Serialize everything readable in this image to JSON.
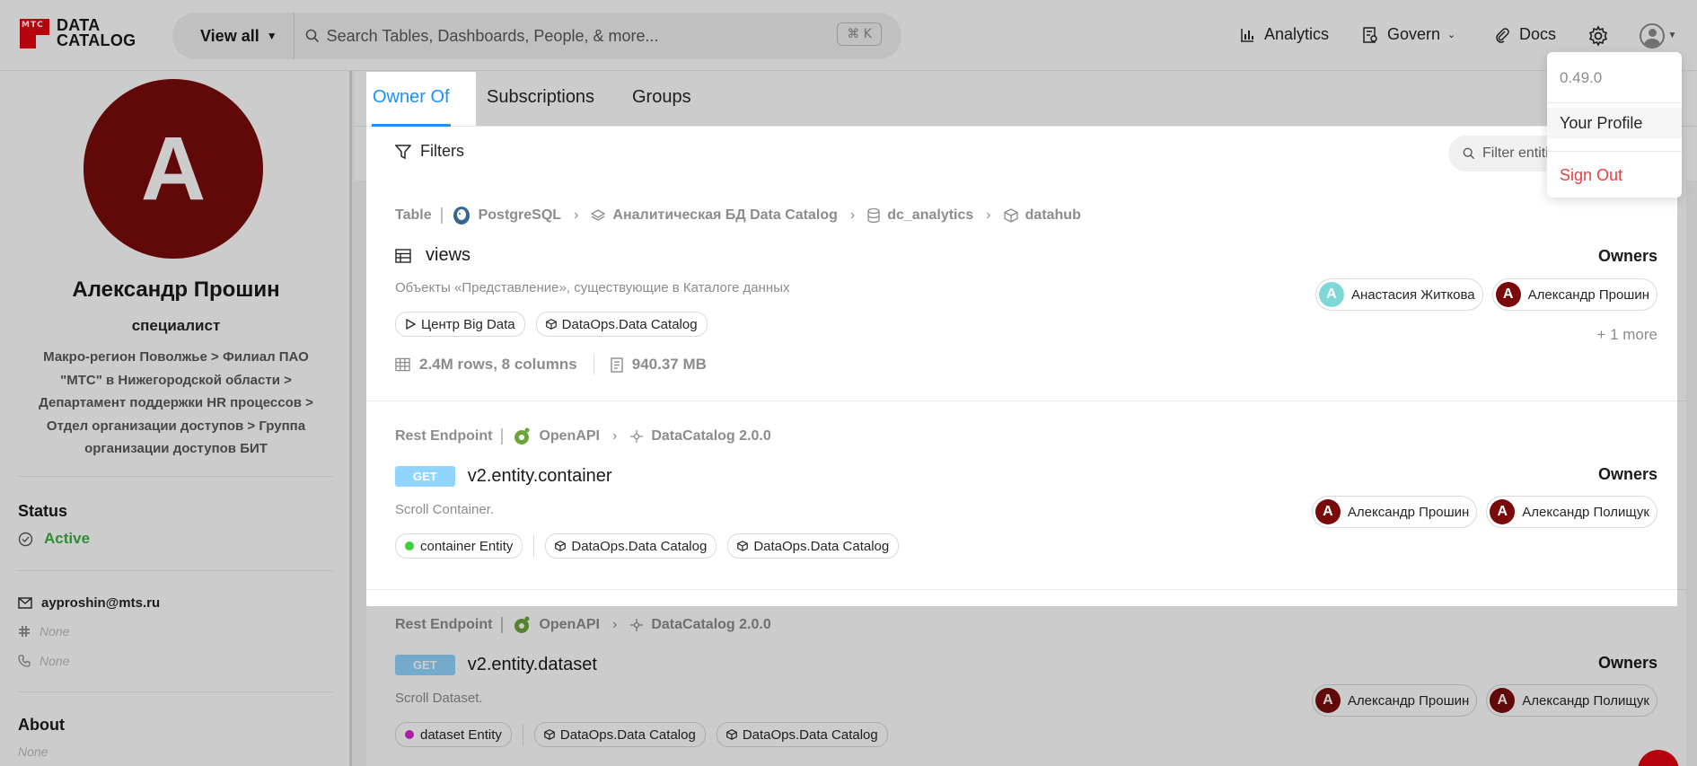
{
  "header": {
    "logo_text_line1": "DATA",
    "logo_text_line2": "CATALOG",
    "logo_mark_text": "MTC",
    "view_all_label": "View all",
    "search_placeholder": "Search Tables, Dashboards, People, & more...",
    "shortcut": "⌘ K",
    "nav": {
      "analytics": "Analytics",
      "govern": "Govern",
      "docs": "Docs"
    }
  },
  "profile": {
    "avatar_letter": "A",
    "name": "Александр Прошин",
    "title": "специалист",
    "org": "Макро-регион Поволжье > Филиал ПАО \"МТС\" в Нижегородской области > Департамент поддержки HR процессов > Отдел организации доступов > Группа организации доступов БИТ",
    "status_label": "Status",
    "status_value": "Active",
    "email": "ayproshin@mts.ru",
    "slack": "None",
    "phone": "None",
    "about_label": "About",
    "about_value": "None"
  },
  "tabs": {
    "owner_of": "Owner Of",
    "subscriptions": "Subscriptions",
    "groups": "Groups"
  },
  "filters": {
    "button_label": "Filters",
    "search_placeholder": "Filter entiti"
  },
  "results": [
    {
      "type": "Table",
      "platform": "PostgreSQL",
      "path": [
        "Аналитическая БД Data Catalog",
        "dc_analytics",
        "datahub"
      ],
      "title": "views",
      "description": "Объекты «Представление», существующие в Каталоге данных",
      "tags": [
        "Центр Big Data",
        "DataOps.Data Catalog"
      ],
      "stats_rows": "2.4M rows, 8 columns",
      "stats_size": "940.37 MB",
      "owners_label": "Owners",
      "owners": [
        {
          "letter": "А",
          "name": "Анастасия Житкова",
          "color": "#7fd8d8"
        },
        {
          "letter": "А",
          "name": "Александр Прошин",
          "color": "#7a0a0a"
        }
      ],
      "more": "+ 1 more"
    },
    {
      "type": "Rest Endpoint",
      "platform": "OpenAPI",
      "path": [
        "DataCatalog 2.0.0"
      ],
      "method": "GET",
      "title": "v2.entity.container",
      "description": "Scroll Container.",
      "tags": [
        "container Entity",
        "DataOps.Data Catalog",
        "DataOps.Data Catalog"
      ],
      "term_color": "#3cd13c",
      "owners_label": "Owners",
      "owners": [
        {
          "letter": "А",
          "name": "Александр Прошин",
          "color": "#7a0a0a"
        },
        {
          "letter": "А",
          "name": "Александр Полищук",
          "color": "#7a0a0a"
        }
      ]
    },
    {
      "type": "Rest Endpoint",
      "platform": "OpenAPI",
      "path": [
        "DataCatalog 2.0.0"
      ],
      "method": "GET",
      "title": "v2.entity.dataset",
      "description": "Scroll Dataset.",
      "tags": [
        "dataset Entity",
        "DataOps.Data Catalog",
        "DataOps.Data Catalog"
      ],
      "term_color": "#d626d6",
      "owners_label": "Owners",
      "owners": [
        {
          "letter": "А",
          "name": "Александр Прошин",
          "color": "#7a0a0a"
        },
        {
          "letter": "А",
          "name": "Александр Полищук",
          "color": "#7a0a0a"
        }
      ]
    }
  ],
  "user_menu": {
    "version": "0.49.0",
    "profile": "Your Profile",
    "sign_out": "Sign Out"
  },
  "colors": {
    "accent": "#1890ff",
    "brand": "#e30611",
    "active": "#3cb043",
    "danger": "#e84040"
  }
}
